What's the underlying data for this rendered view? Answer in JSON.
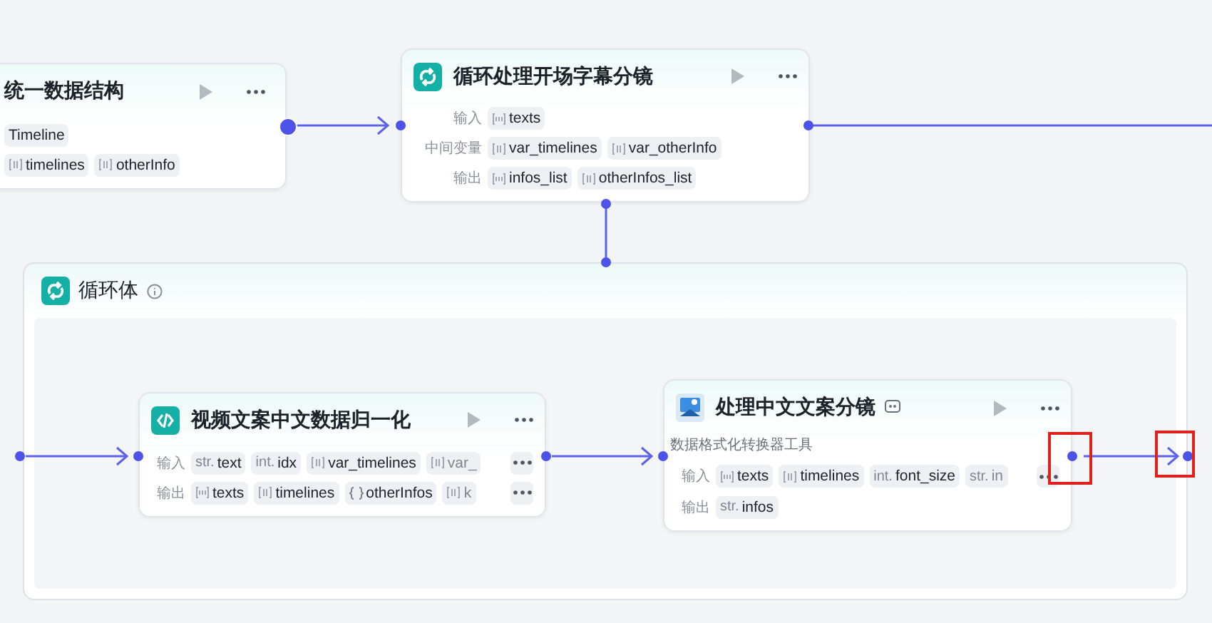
{
  "nodes": [
    {
      "kind": "code-partial",
      "title": "统一数据结构",
      "rows": [
        {
          "tags": [
            {
              "kind": "plain",
              "name": "Timeline"
            }
          ]
        },
        {
          "tags": [
            {
              "kind": "array",
              "name": "timelines"
            },
            {
              "kind": "array",
              "name": "otherInfo"
            }
          ]
        }
      ]
    },
    {
      "kind": "loop",
      "title": "循环处理开场字幕分镜",
      "rows": [
        {
          "label": "输入",
          "tags": [
            {
              "kind": "array-str",
              "name": "texts"
            }
          ]
        },
        {
          "label": "中间变量",
          "tags": [
            {
              "kind": "array",
              "name": "var_timelines"
            },
            {
              "kind": "array",
              "name": "var_otherInfo"
            }
          ]
        },
        {
          "label": "输出",
          "tags": [
            {
              "kind": "array-str",
              "name": "infos_list"
            },
            {
              "kind": "array",
              "name": "otherInfos_list"
            }
          ]
        }
      ]
    },
    {
      "kind": "code",
      "title": "视频文案中文数据归一化",
      "rows": [
        {
          "label": "输入",
          "more": true,
          "tags": [
            {
              "kind": "typed",
              "type": "str.",
              "name": "text"
            },
            {
              "kind": "typed",
              "type": "int.",
              "name": "idx"
            },
            {
              "kind": "array",
              "name": "var_timelines"
            },
            {
              "kind": "array",
              "name": "var_",
              "faded": true
            }
          ]
        },
        {
          "label": "输出",
          "more": true,
          "tags": [
            {
              "kind": "array-str",
              "name": "texts"
            },
            {
              "kind": "array",
              "name": "timelines"
            },
            {
              "kind": "object",
              "name": "otherInfos"
            },
            {
              "kind": "array",
              "name": "k",
              "faded": true
            }
          ]
        }
      ]
    },
    {
      "kind": "plugin",
      "title": "处理中文文案分镜",
      "description": "数据格式化转换器工具",
      "rows": [
        {
          "label": "输入",
          "more": true,
          "tags": [
            {
              "kind": "array-str",
              "name": "texts"
            },
            {
              "kind": "array",
              "name": "timelines"
            },
            {
              "kind": "typed",
              "type": "int.",
              "name": "font_size"
            },
            {
              "kind": "typed",
              "type": "str.",
              "name": "in",
              "faded": true
            }
          ]
        },
        {
          "label": "输出",
          "tags": [
            {
              "kind": "typed",
              "type": "str.",
              "name": "infos"
            }
          ]
        }
      ]
    }
  ],
  "loop_body": {
    "title": "循环体"
  }
}
